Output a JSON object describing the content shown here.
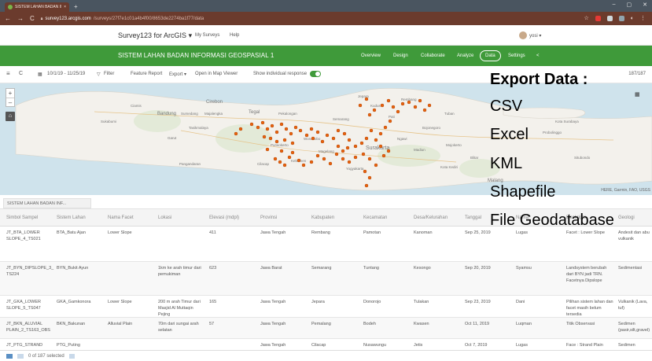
{
  "browser": {
    "tab_title": "SISTEM LAHAN BADAN INFORM",
    "tab_close": "×",
    "new_tab": "+",
    "url_host": "survey123.arcgis.com",
    "url_path": "/surveys/27f7e1c01a4b4f00/8653de2274ba1f77/data",
    "win_min": "–",
    "win_max": "▢",
    "win_close": "✕"
  },
  "header": {
    "app_title": "Survey123 for ArcGIS",
    "app_caret": "▾",
    "my_surveys": "My Surveys",
    "help": "Help",
    "user": "yosi ▾"
  },
  "greenbar": {
    "survey_name": "SISTEM LAHAN BADAN INFORMASI GEOSPASIAL 1",
    "nav": [
      "Overview",
      "Design",
      "Collaborate",
      "Analyze",
      "Data",
      "Settings"
    ],
    "active_nav": "Data",
    "share_icon": "<"
  },
  "toolbar": {
    "menu_icon": "≡",
    "refresh_icon": "C",
    "date_range": "10/1/19 - 11/25/19",
    "filter": "Filter",
    "feature_report": "Feature Report",
    "export": "Export ▾",
    "open_map_viewer": "Open in Map Viewer",
    "show_individual": "Show individual response",
    "record_count": "187/187"
  },
  "map": {
    "zoom_in": "+",
    "zoom_out": "–",
    "home": "⌂",
    "grid_icon": "▦",
    "attribution": "HERE, Garmin, FAO, USGS",
    "labels": [
      "Cirebon",
      "Tegal",
      "Pekalongan",
      "Semarang",
      "Kudus",
      "Rembang",
      "Tuban",
      "Bandung",
      "Sumedang",
      "Majalengka",
      "Cilacap",
      "Purwokerto",
      "Kebumen",
      "Magelang",
      "Surakarta",
      "Madiun",
      "Ngawi",
      "Bojonegoro",
      "Mojokerto",
      "Kota Surabaya",
      "Probolinggo",
      "Malang",
      "Kota Kediri",
      "Tasikmalaya",
      "Garut",
      "Pangandaran",
      "Yogyakarta",
      "Wonosobo",
      "Pati",
      "Jepara",
      "Sukabumi",
      "Ciamis",
      "Blitar",
      "Situbondo"
    ]
  },
  "export_overlay": {
    "title": "Export Data :",
    "items": [
      "CSV",
      "Excel",
      "KML",
      "Shapefile",
      "File Geodatabase"
    ]
  },
  "table": {
    "layer_tab": "SISTEM LAHAN BADAN INF...",
    "columns": [
      "Simbol Sampel",
      "Sistem Lahan",
      "Nama Facet",
      "Lokasi",
      "Elevasi (mdpl)",
      "Provinsi",
      "Kabupaten",
      "Kecamatan",
      "Desa/Kelurahan",
      "Tanggal",
      "Nama",
      "Deskripsi",
      "Geologi"
    ],
    "rows": [
      [
        "JT_BTA_LOWER SLOPE_4_TS021",
        "BTA_Batu Ajan",
        "Lower Slope",
        "",
        "411",
        "Jawa Tengah",
        "Rembang",
        "Pamotan",
        "Kanoman",
        "Sep 25, 2019",
        "Lugas",
        "Facet : Lower Slope",
        "Andesit dan abu vulkanik"
      ],
      [
        "JT_BYN_DIPSLOPE_3_ TS224",
        "BYN_Bukit Ayun",
        "",
        "1km ke arah timur dari pemukiman",
        "623",
        "Jawa Barat",
        "Semarang",
        "Tuntang",
        "Kesongo",
        "Sep 20, 2019",
        "Syamsu",
        "Landsystem berubah dari BYN jadi TRN. Facetnya Dipslope",
        "Sedimentasi"
      ],
      [
        "JT_GKA_LOWER SLOPE_5_TS047",
        "GKA_Gamkonora",
        "Lower Slope",
        "200 m arah Timur dari Masjid Al Muttaqin Pejing",
        "165",
        "Jawa Tengah",
        "Jepara",
        "Donorojo",
        "Tulakan",
        "Sep 23, 2019",
        "Dani",
        "Pilihan sistem lahan dan facet masih belum tersedia",
        "Vulkanik (Lava, tuf)"
      ],
      [
        "JT_BKN_ALUVIAL PLAIN_2_TS163_OBS",
        "BKN_Bakunan",
        "Alluvial Plain",
        "70m dari sungai arah selatan",
        "57",
        "Jawa Tengah",
        "Pemalang",
        "Bodeh",
        "Kwasen",
        "Oct 11, 2019",
        "Luqman",
        "Titik Observasi",
        "Sedimen (pasir,silt,gravel)"
      ],
      [
        "JT_PTG_STRAND",
        "PTG_Puting",
        "",
        "",
        "",
        "Jawa Tengah",
        "Cilacap",
        "Nusawungu",
        "Jetis",
        "Oct 7, 2019",
        "Lugas",
        "Face : Strand Plain",
        "Sedimen"
      ]
    ]
  },
  "footer": {
    "selected": "0 of 187 selected"
  }
}
